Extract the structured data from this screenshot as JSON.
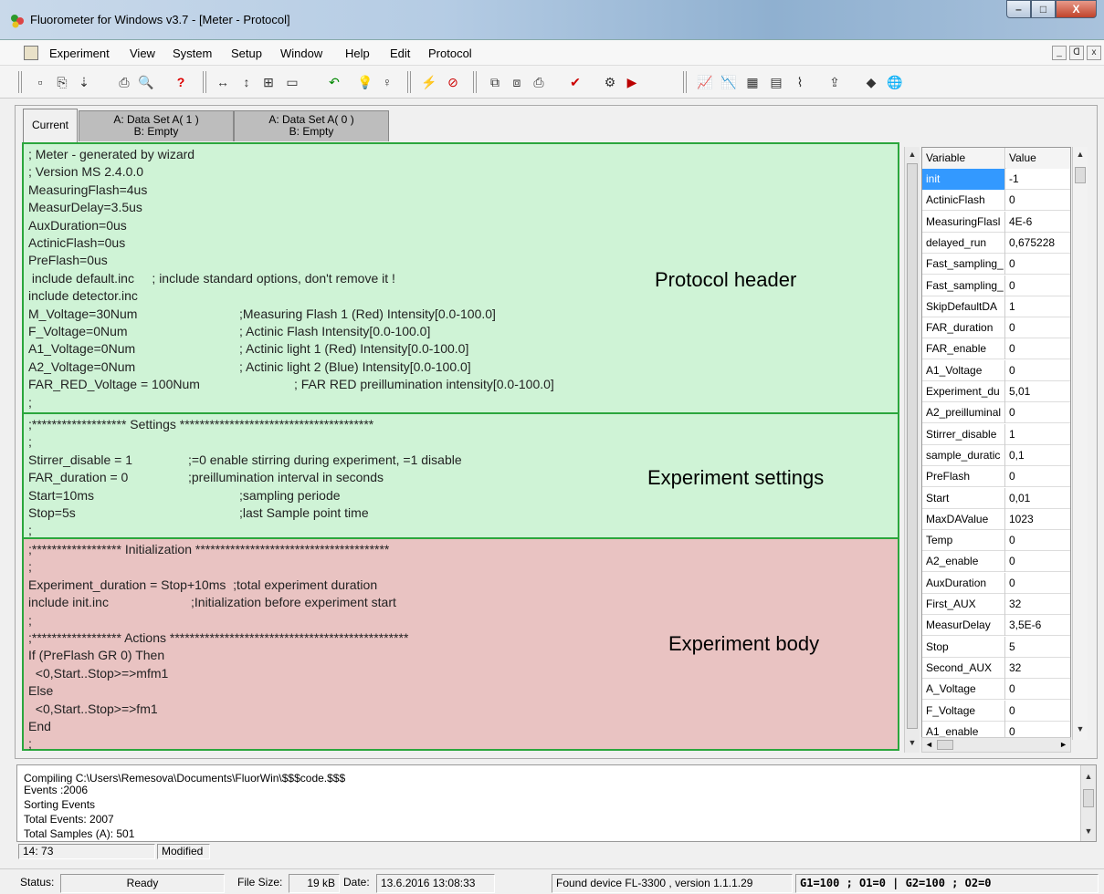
{
  "window": {
    "title": "Fluorometer for Windows v3.7 - [Meter - Protocol]",
    "minimize": "–",
    "maximize": "□",
    "close": "X"
  },
  "menu": {
    "items": [
      "Experiment",
      "View",
      "System",
      "Setup",
      "Window",
      "Help",
      "Edit",
      "Protocol"
    ],
    "mdi_controls": [
      "_",
      "ᗡ",
      "x"
    ]
  },
  "toolbar": {
    "buttons": [
      {
        "icon": "new-icon",
        "glyph": "▫"
      },
      {
        "icon": "open-icon",
        "glyph": "⎘"
      },
      {
        "icon": "save-icon",
        "glyph": "⇣"
      },
      {
        "icon": "print-icon",
        "glyph": "⎙"
      },
      {
        "icon": "print-preview-icon",
        "glyph": "🔍"
      },
      {
        "icon": "help-icon",
        "glyph": "?"
      },
      {
        "icon": "fit-width-icon",
        "glyph": "↔"
      },
      {
        "icon": "fit-height-icon",
        "glyph": "↕"
      },
      {
        "icon": "zoom-fit-icon",
        "glyph": "⊞"
      },
      {
        "icon": "window-icon",
        "glyph": "▭"
      },
      {
        "icon": "undo-icon",
        "glyph": "↶"
      },
      {
        "icon": "bulb-on-icon",
        "glyph": "💡"
      },
      {
        "icon": "bulb-off-icon",
        "glyph": "♀"
      },
      {
        "icon": "flash-icon",
        "glyph": "⚡"
      },
      {
        "icon": "stop-icon",
        "glyph": "⊘"
      },
      {
        "icon": "copy-icon",
        "glyph": "⧉"
      },
      {
        "icon": "paste-icon",
        "glyph": "⧈"
      },
      {
        "icon": "print2-icon",
        "glyph": "⎙"
      },
      {
        "icon": "check-icon",
        "glyph": "✔"
      },
      {
        "icon": "compile-icon",
        "glyph": "⚙"
      },
      {
        "icon": "run-icon",
        "glyph": "▶"
      },
      {
        "icon": "graph1-icon",
        "glyph": "📈"
      },
      {
        "icon": "graph2-icon",
        "glyph": "📉"
      },
      {
        "icon": "graph3-icon",
        "glyph": "▦"
      },
      {
        "icon": "graph4-icon",
        "glyph": "▤"
      },
      {
        "icon": "graph5-icon",
        "glyph": "⌇"
      },
      {
        "icon": "export-icon",
        "glyph": "⇪"
      },
      {
        "icon": "device-icon",
        "glyph": "◆"
      },
      {
        "icon": "globe-icon",
        "glyph": "🌐"
      }
    ]
  },
  "tabs": [
    {
      "line1": "Current",
      "line2": ""
    },
    {
      "line1": "A: Data Set A( 1 )",
      "line2": "B: Empty"
    },
    {
      "line1": "A: Data Set A( 0 )",
      "line2": "B: Empty"
    }
  ],
  "editor": {
    "header_lines": [
      {
        "code": "; Meter - generated by wizard",
        "comment": ""
      },
      {
        "code": "; Version MS 2.4.0.0",
        "comment": ""
      },
      {
        "code": "MeasuringFlash=4us",
        "comment": ""
      },
      {
        "code": "MeasurDelay=3.5us",
        "comment": ""
      },
      {
        "code": "AuxDuration=0us",
        "comment": ""
      },
      {
        "code": "ActinicFlash=0us",
        "comment": ""
      },
      {
        "code": "PreFlash=0us",
        "comment": ""
      },
      {
        "code": " include default.inc     ; include standard options, don't remove it !",
        "comment": ""
      },
      {
        "code": "include detector.inc",
        "comment": ""
      },
      {
        "code": "M_Voltage=30Num",
        "comment": ";Measuring Flash 1 (Red) Intensity[0.0-100.0]"
      },
      {
        "code": "F_Voltage=0Num",
        "comment": "; Actinic Flash Intensity[0.0-100.0]"
      },
      {
        "code": "A1_Voltage=0Num",
        "comment": "; Actinic light 1 (Red) Intensity[0.0-100.0]"
      },
      {
        "code": "A2_Voltage=0Num",
        "comment": "; Actinic light 2 (Blue) Intensity[0.0-100.0]"
      },
      {
        "code": "FAR_RED_Voltage = 100Num",
        "comment": "; FAR RED preillumination intensity[0.0-100.0]"
      },
      {
        "code": ";",
        "comment": ""
      }
    ],
    "settings_lines": [
      {
        "code": ";******************* Settings ***************************************",
        "comment": ""
      },
      {
        "code": ";",
        "comment": ""
      },
      {
        "code": "Stirrer_disable = 1",
        "comment": ";=0 enable stirring during experiment, =1 disable"
      },
      {
        "code": "FAR_duration = 0",
        "comment": ";preillumination interval in seconds"
      },
      {
        "code": "Start=10ms",
        "comment": ";sampling periode"
      },
      {
        "code": "Stop=5s",
        "comment": ";last Sample point time"
      },
      {
        "code": ";",
        "comment": ""
      }
    ],
    "body_lines": [
      {
        "code": ";****************** Initialization ***************************************",
        "comment": ""
      },
      {
        "code": ";",
        "comment": ""
      },
      {
        "code": "Experiment_duration = Stop+10ms  ;total experiment duration",
        "comment": ""
      },
      {
        "code": "include init.inc",
        "comment": ";Initialization before experiment start"
      },
      {
        "code": ";",
        "comment": ""
      },
      {
        "code": ";****************** Actions ************************************************",
        "comment": ""
      },
      {
        "code": "If (PreFlash GR 0) Then",
        "comment": ""
      },
      {
        "code": "  <0,Start..Stop>=>mfm1",
        "comment": ""
      },
      {
        "code": "Else",
        "comment": ""
      },
      {
        "code": "  <0,Start..Stop>=>fm1",
        "comment": ""
      },
      {
        "code": "End",
        "comment": ""
      },
      {
        "code": ";",
        "comment": ""
      }
    ],
    "labels": {
      "header": "Protocol header",
      "settings": "Experiment settings",
      "body": "Experiment body"
    }
  },
  "grid": {
    "col_variable": "Variable",
    "col_value": "Value",
    "rows": [
      {
        "name": "init",
        "value": "-1"
      },
      {
        "name": "ActinicFlash",
        "value": "0"
      },
      {
        "name": "MeasuringFlasl",
        "value": "4E-6"
      },
      {
        "name": "delayed_run",
        "value": "0,675228"
      },
      {
        "name": "Fast_sampling_",
        "value": "0"
      },
      {
        "name": "Fast_sampling_",
        "value": "0"
      },
      {
        "name": "SkipDefaultDA",
        "value": "1"
      },
      {
        "name": "FAR_duration",
        "value": "0"
      },
      {
        "name": "FAR_enable",
        "value": "0"
      },
      {
        "name": "A1_Voltage",
        "value": "0"
      },
      {
        "name": "Experiment_du",
        "value": "5,01"
      },
      {
        "name": "A2_preilluminal",
        "value": "0"
      },
      {
        "name": "Stirrer_disable",
        "value": "1"
      },
      {
        "name": "sample_duratic",
        "value": "0,1"
      },
      {
        "name": "PreFlash",
        "value": "0"
      },
      {
        "name": "Start",
        "value": "0,01"
      },
      {
        "name": "MaxDAValue",
        "value": "1023"
      },
      {
        "name": "Temp",
        "value": "0"
      },
      {
        "name": "A2_enable",
        "value": "0"
      },
      {
        "name": "AuxDuration",
        "value": "0"
      },
      {
        "name": "First_AUX",
        "value": "32"
      },
      {
        "name": "MeasurDelay",
        "value": "3,5E-6"
      },
      {
        "name": "Stop",
        "value": "5"
      },
      {
        "name": "Second_AUX",
        "value": "32"
      },
      {
        "name": "A_Voltage",
        "value": "0"
      },
      {
        "name": "F_Voltage",
        "value": "0"
      },
      {
        "name": "A1_enable",
        "value": "0"
      }
    ]
  },
  "log": {
    "lines": [
      "Compiling C:\\Users\\Remesova\\Documents\\FluorWin\\$$$code.$$$",
      "Events  :2006",
      "Sorting Events",
      "Total Events: 2007",
      "Total Samples (A): 501"
    ]
  },
  "position": {
    "cursor": "14:  73",
    "state": "Modified"
  },
  "status": {
    "label": "Status:",
    "value": "Ready",
    "filesize_label": "File Size:",
    "filesize": "19 kB",
    "date_label": "Date:",
    "date": "13.6.2016 13:08:33",
    "device": "Found device FL-3300 , version 1.1.1.29",
    "gains": "G1=100 ; O1=0   |   G2=100 ; O2=0"
  }
}
